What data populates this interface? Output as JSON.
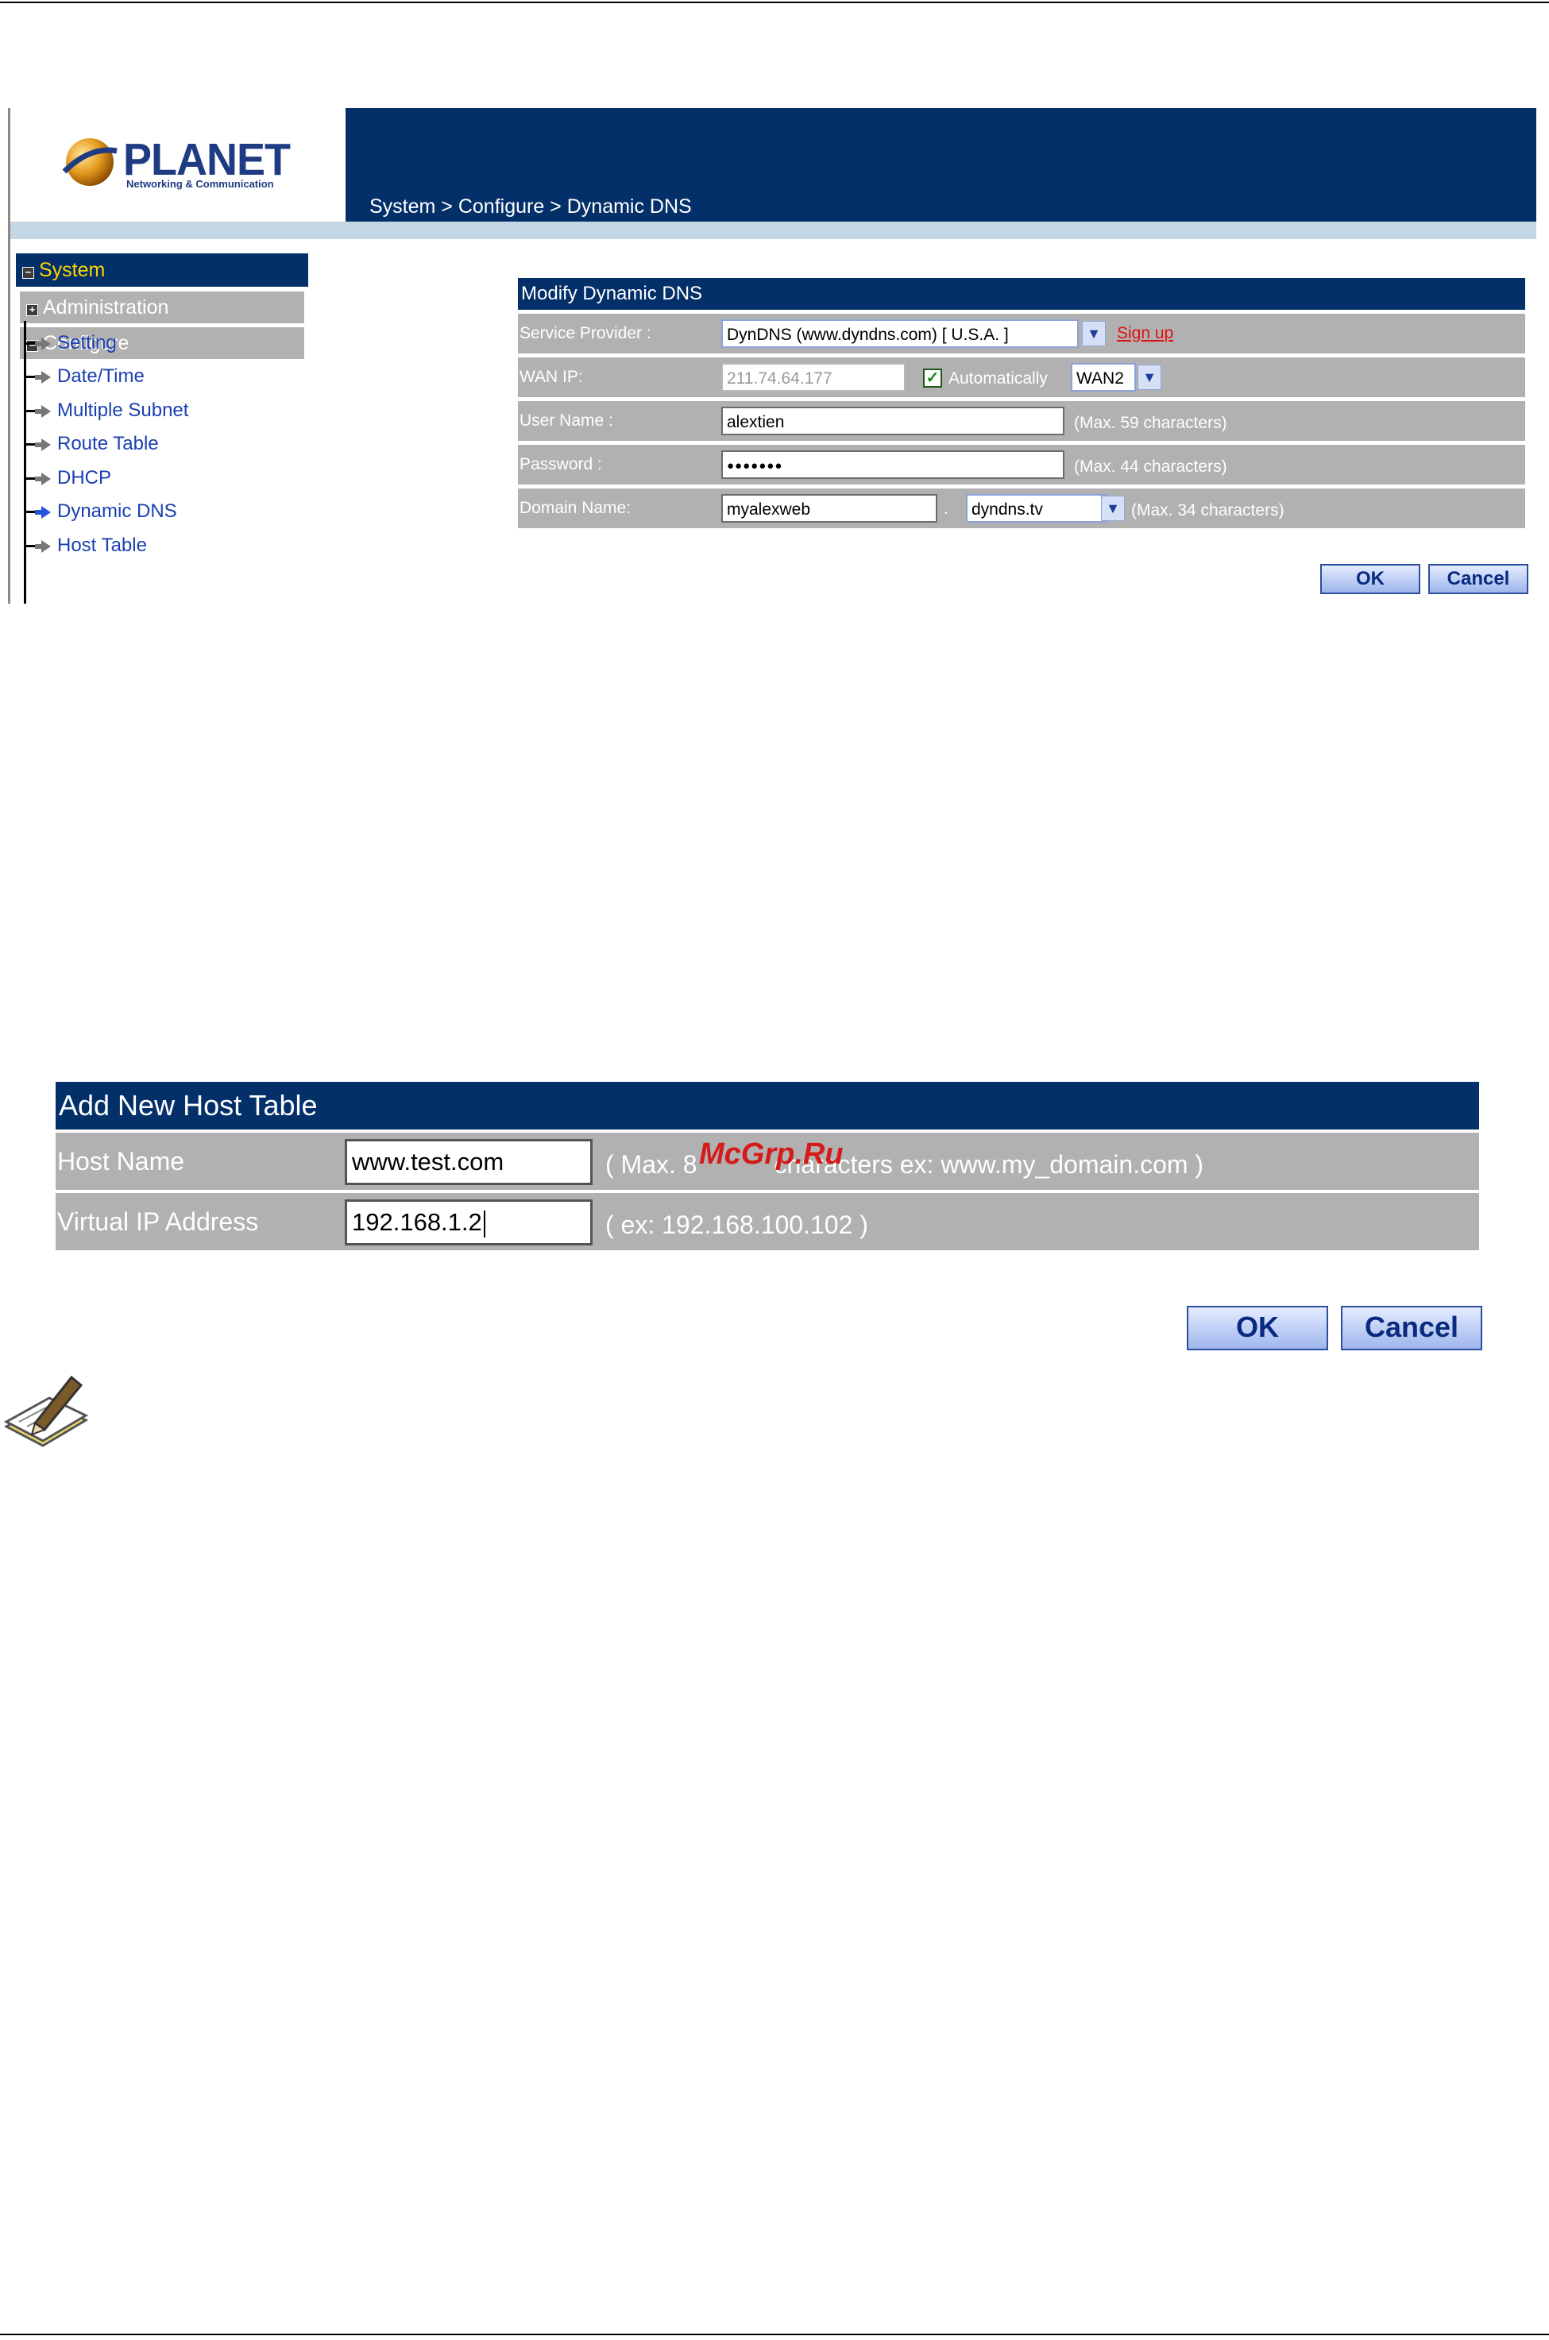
{
  "breadcrumb": "System > Configure > Dynamic DNS",
  "logo": {
    "name": "PLANET",
    "tagline": "Networking & Communication"
  },
  "sidebar": {
    "system": "System",
    "administration": "Administration",
    "configure": "Configure",
    "items": [
      "Setting",
      "Date/Time",
      "Multiple Subnet",
      "Route Table",
      "DHCP",
      "Dynamic DNS",
      "Host Table"
    ],
    "active": "Dynamic DNS"
  },
  "ddns_form": {
    "title": "Modify Dynamic DNS",
    "service_provider": {
      "label": "Service Provider :",
      "value": "DynDNS (www.dyndns.com) [ U.S.A. ]",
      "signup": "Sign up"
    },
    "wan_ip": {
      "label": "WAN IP:",
      "value": "211.74.64.177",
      "auto_label": "Automatically",
      "auto_checked": true,
      "wan_select": "WAN2"
    },
    "user_name": {
      "label": "User Name :",
      "value": "alextien",
      "hint": "(Max. 59 characters)"
    },
    "password": {
      "label": "Password :",
      "value": "●●●●●●●",
      "hint": "(Max. 44 characters)"
    },
    "domain_name": {
      "label": "Domain Name:",
      "value": "myalexweb",
      "dot": ".",
      "domain_select": "dyndns.tv",
      "hint": "(Max. 34 characters)"
    },
    "ok": "OK",
    "cancel": "Cancel"
  },
  "host_form": {
    "title": "Add New Host Table",
    "host_name": {
      "label": "Host Name",
      "value": "www.test.com",
      "hint": "( Max. 8",
      "hint_rest": "characters ex: www.my_domain.com )"
    },
    "virtual_ip": {
      "label": "Virtual IP Address",
      "value": "192.168.1.2",
      "hint": "( ex: 192.168.100.102 )"
    },
    "ok": "OK",
    "cancel": "Cancel"
  },
  "watermark": "McGrp.Ru",
  "colors": {
    "navy": "#04306a",
    "row_gray": "#b1b1b1",
    "link_blue": "#1a3fb0",
    "system_yellow": "#ffd400"
  }
}
